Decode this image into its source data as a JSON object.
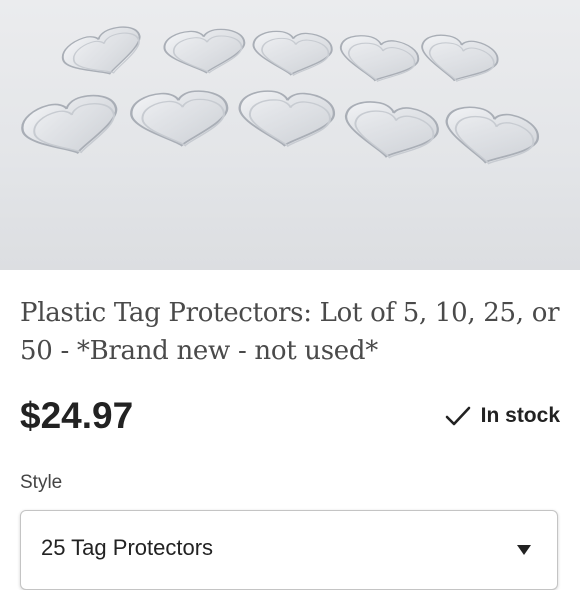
{
  "product": {
    "image_alt": "Clear plastic heart-shaped tag protectors",
    "title": "Plastic Tag Protectors: Lot of 5, 10, 25, or 50 - *Brand new - not used*",
    "price": "$24.97",
    "stock_status": "In stock",
    "stock_icon": "check-icon"
  },
  "style": {
    "label": "Style",
    "selected": "25 Tag Protectors",
    "icon": "chevron-down-icon"
  },
  "colors": {
    "text": "#222222",
    "title_text": "#4a4a4a",
    "photo_background": "#e4e6e9"
  }
}
